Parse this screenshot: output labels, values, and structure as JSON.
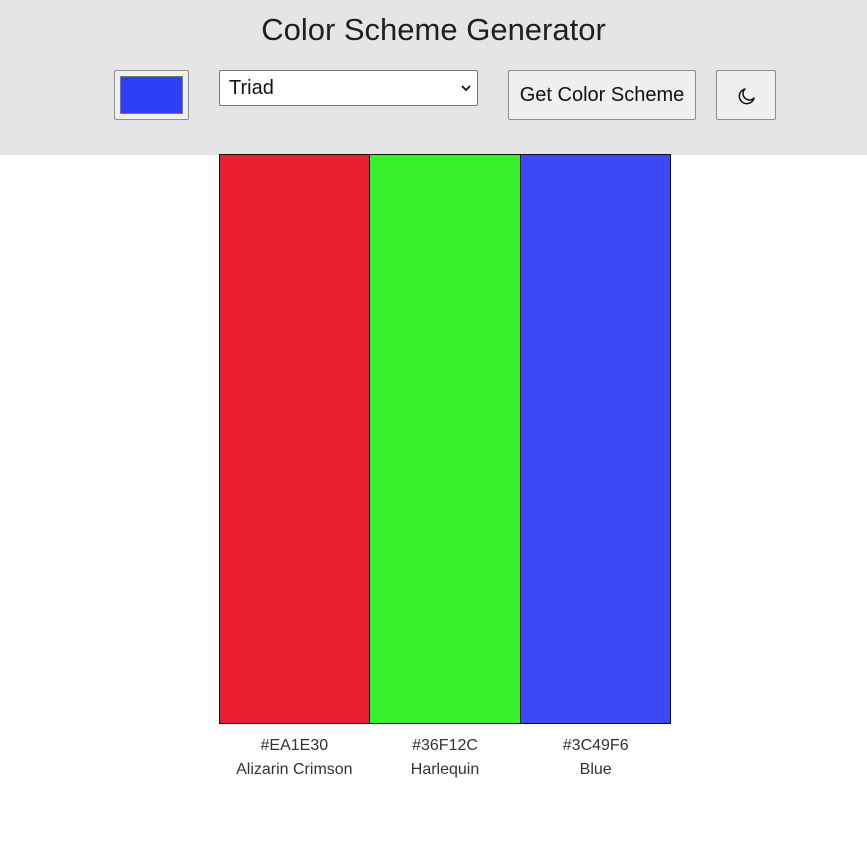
{
  "header": {
    "title": "Color Scheme Generator",
    "seed_color": "#2e3ff5",
    "mode_selected": "Triad",
    "get_button_label": "Get Color Scheme",
    "theme_toggle_icon": "moon-icon"
  },
  "scheme": {
    "colors": [
      {
        "hex": "#EA1E30",
        "name": "Alizarin Crimson"
      },
      {
        "hex": "#36F12C",
        "name": "Harlequin"
      },
      {
        "hex": "#3C49F6",
        "name": "Blue"
      }
    ]
  }
}
